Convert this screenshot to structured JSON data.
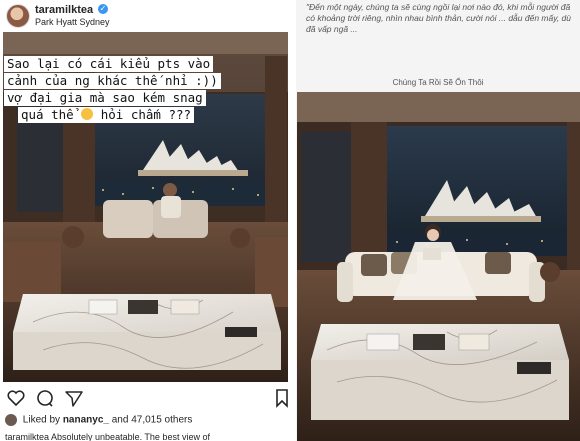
{
  "post": {
    "username": "taramilktea",
    "location": "Park Hyatt Sydney",
    "likes_prefix": "Liked by",
    "liked_by": "nananyc_",
    "likes_suffix": "and 47,015 others",
    "caption": "taramilktea Absolutely unbeatable. The best view of"
  },
  "story": {
    "quote": "\"Đến một ngày, chúng ta sẽ cùng ngồi lại nơi nào đó, khi mỗi người đã có khoảng trời riêng, nhìn nhau bình thản, cười nói ... dẫu đến mấy, dù đã vấp ngã ...",
    "book_title": "Chúng Ta Rồi Sẽ Ổn Thôi",
    "overlay_lines": [
      "Sao lại có cái kiểu pts vào",
      "cảnh của ng khác thế nhỉ :))",
      "vợ đại gia mà sao kém snag",
      "quá thể",
      "hỏi chấm ???"
    ]
  },
  "icons": [
    "verified-badge-icon",
    "heart-icon",
    "comment-icon",
    "share-icon",
    "bookmark-icon",
    "smile-emoji-icon"
  ]
}
